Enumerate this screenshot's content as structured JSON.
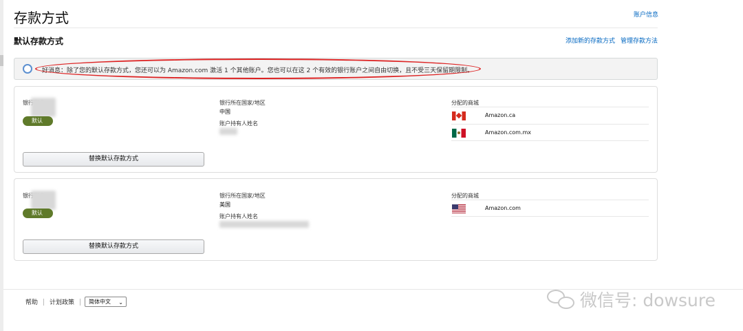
{
  "header": {
    "title": "存款方式",
    "account_info_link": "账户信息"
  },
  "section": {
    "title": "默认存款方式",
    "add_link": "添加新的存款方式",
    "manage_link": "管理存款方法"
  },
  "notice": {
    "text": "好消息：除了您的默认存款方式，您还可以为 Amazon.com 激活 1 个其他账户。您也可以在这 2 个有效的银行账户之间自由切换，且不受三天保留期限制。"
  },
  "cards": [
    {
      "bank_account_label": "银行账户",
      "default_badge": "默认",
      "country_label": "银行所在国家/地区",
      "country_value": "中国",
      "holder_label": "账户持有人姓名",
      "marketplaces_label": "分配的商城",
      "marketplaces": [
        {
          "name": "Amazon.ca",
          "flag": "canada-flag"
        },
        {
          "name": "Amazon.com.mx",
          "flag": "mexico-flag"
        }
      ],
      "replace_button": "替换默认存款方式"
    },
    {
      "bank_account_label": "银行账户",
      "default_badge": "默认",
      "country_label": "银行所在国家/地区",
      "country_value": "美国",
      "holder_label": "账户持有人姓名",
      "marketplaces_label": "分配的商城",
      "marketplaces": [
        {
          "name": "Amazon.com",
          "flag": "usa-flag"
        }
      ],
      "replace_button": "替换默认存款方式"
    }
  ],
  "footer": {
    "help": "帮助",
    "policy": "计划政策",
    "language": "简体中文"
  },
  "watermark": {
    "text": "微信号: dowsure"
  },
  "colors": {
    "link": "#0066c0",
    "badge": "#5f7a2a",
    "annotation_oval": "#dd2222"
  }
}
